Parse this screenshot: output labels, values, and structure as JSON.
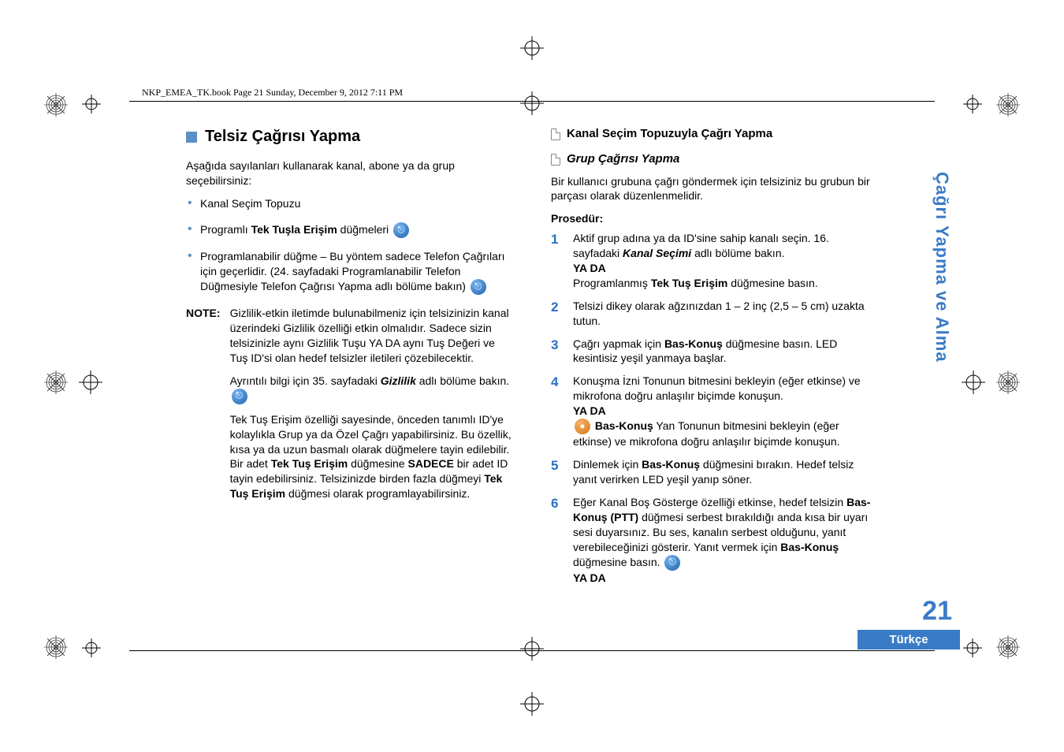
{
  "header": {
    "running_head": "NKP_EMEA_TK.book  Page 21  Sunday, December 9, 2012  7:11 PM"
  },
  "sidebar": {
    "section_label": "Çağrı Yapma ve Alma",
    "page_number": "21",
    "language": "Türkçe"
  },
  "left": {
    "heading": "Telsiz Çağrısı Yapma",
    "intro": "Aşağıda sayılanları kullanarak kanal, abone ya da grup seçebilirsiniz:",
    "bullets": {
      "b1": "Kanal Seçim Topuzu",
      "b2_pre": "Programlı ",
      "b2_bold": "Tek Tuşla Erişim",
      "b2_post": " düğmeleri",
      "b3_pre": "Programlanabilir düğme – Bu yöntem sadece Telefon Çağrıları için geçerlidir. (24. sayfadaki Programlanabilir Telefon Düğmesiyle Telefon Çağrısı Yapma adlı bölüme bakın)",
      "b3_post": ""
    },
    "note_label": "NOTE:",
    "note_p1": "Gizlilik-etkin iletimde bulunabilmeniz için telsizinizin kanal üzerindeki Gizlilik özelliği etkin olmalıdır. Sadece sizin telsizinizle aynı Gizlilik Tuşu YA DA aynı Tuş Değeri ve Tuş ID'si olan hedef telsizler iletileri çözebilecektir.",
    "note_p2_pre": "Ayrıntılı bilgi için 35. sayfadaki ",
    "note_p2_bold": "Gizlilik",
    "note_p2_post": " adlı bölüme bakın.",
    "note_p3_a": "Tek Tuş Erişim özelliği sayesinde, önceden tanımlı ID'ye kolaylıkla Grup ya da Özel Çağrı yapabilirsiniz. Bu özellik, kısa ya da uzun basmalı olarak düğmelere tayin edilebilir. Bir adet ",
    "note_p3_b": "Tek Tuş Erişim",
    "note_p3_c": " düğmesine ",
    "note_p3_d": "SADECE",
    "note_p3_e": " bir adet ID tayin edebilirsiniz. Telsizinizde birden fazla düğmeyi ",
    "note_p3_f": "Tek Tuş Erişim",
    "note_p3_g": " düğmesi olarak programlayabilirsiniz."
  },
  "right": {
    "sub1": "Kanal Seçim Topuzuyla Çağrı Yapma",
    "sub2": "Grup Çağrısı Yapma",
    "p1": "Bir kullanıcı grubuna çağrı göndermek için telsiziniz bu grubun bir parçası olarak düzenlenmelidir.",
    "procedure_label": "Prosedür:",
    "steps": {
      "s1_a": "Aktif grup adına ya da ID'sine sahip kanalı seçin. 16. sayfadaki ",
      "s1_b": "Kanal Seçimi",
      "s1_c": " adlı bölüme bakın.",
      "s1_or": "YA DA",
      "s1_d_pre": "Programlanmış ",
      "s1_d_bold": "Tek Tuş Erişim",
      "s1_d_post": " düğmesine basın.",
      "s2": "Telsizi dikey olarak ağzınızdan 1 – 2 inç (2,5 – 5 cm) uzakta tutun.",
      "s3_a": "Çağrı yapmak için ",
      "s3_b": "Bas-Konuş",
      "s3_c": " düğmesine basın. LED kesintisiz yeşil yanmaya başlar.",
      "s4_a": "Konuşma İzni Tonunun bitmesini bekleyin (eğer etkinse) ve mikrofona doğru anlaşılır biçimde konuşun.",
      "s4_or": "YA DA",
      "s4_b_bold": "Bas-Konuş",
      "s4_b_post": " Yan Tonunun bitmesini bekleyin (eğer etkinse) ve mikrofona doğru anlaşılır biçimde konuşun.",
      "s5_a": "Dinlemek için ",
      "s5_b": "Bas-Konuş",
      "s5_c": " düğmesini bırakın. Hedef telsiz yanıt verirken LED yeşil yanıp söner.",
      "s6_a": "Eğer Kanal Boş Gösterge özelliği etkinse, hedef telsizin ",
      "s6_b": "Bas-Konuş (PTT)",
      "s6_c": " düğmesi serbest bırakıldığı anda kısa bir uyarı sesi duyarsınız. Bu ses, kanalın serbest olduğunu, yanıt verebileceğinizi gösterir. Yanıt vermek için ",
      "s6_d": "Bas-Konuş",
      "s6_e": " düğmesine basın.",
      "s6_or": "YA DA"
    }
  }
}
